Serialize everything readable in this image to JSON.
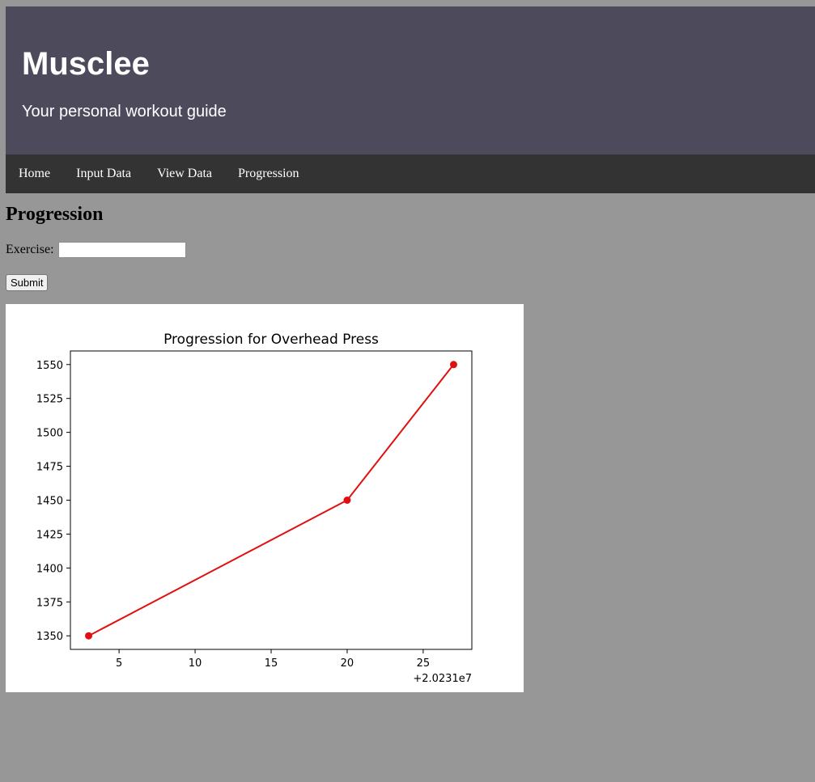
{
  "header": {
    "title": "Musclee",
    "tagline": "Your personal workout guide"
  },
  "nav": {
    "items": [
      "Home",
      "Input Data",
      "View Data",
      "Progression"
    ]
  },
  "main": {
    "heading": "Progression",
    "exercise_label": "Exercise:",
    "exercise_value": "",
    "submit_label": "Submit"
  },
  "colors": {
    "header_bg": "#4d4a5c",
    "nav_bg": "#333333",
    "page_bg": "#979797",
    "series": "#e01010"
  },
  "chart_data": {
    "type": "line",
    "title": "Progression for Overhead Press",
    "x": [
      3,
      20,
      27
    ],
    "y": [
      1350,
      1450,
      1550
    ],
    "x_offset_label": "+2.0231e7",
    "xlim": [
      1.8,
      28.2
    ],
    "ylim": [
      1340,
      1560
    ],
    "xticks": [
      5,
      10,
      15,
      20,
      25
    ],
    "yticks": [
      1350,
      1375,
      1400,
      1425,
      1450,
      1475,
      1500,
      1525,
      1550
    ],
    "grid": false,
    "marker": "circle"
  }
}
